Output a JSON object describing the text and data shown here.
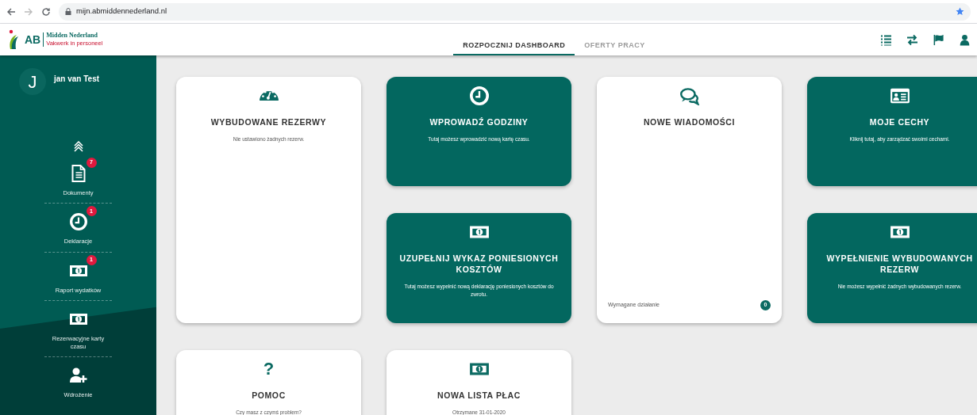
{
  "browser": {
    "url": "mijn.abmiddennederland.nl"
  },
  "logo": {
    "mark": "AB",
    "name": "Midden Nederland",
    "tagline": "Vakwerk in personeel"
  },
  "tabs": [
    {
      "label": "ROZPOCZNIJ DASHBOARD",
      "selected": true
    },
    {
      "label": "OFERTY PRACY",
      "selected": false
    }
  ],
  "user": {
    "initial": "J",
    "name": "jan van Test"
  },
  "sidebar": {
    "items": [
      {
        "label": "Dokumenty",
        "badge": "7"
      },
      {
        "label": "Deklaracje",
        "badge": "1"
      },
      {
        "label": "Raport wydatków",
        "badge": "1"
      },
      {
        "label": "Rezerwacyjne karty czasu"
      },
      {
        "label": "Wdrożenie"
      }
    ]
  },
  "cards": [
    {
      "kind": "tall",
      "highlighted": false,
      "title": "WYBUDOWANE REZERWY",
      "text": "Nie ustawiono żadnych rezerw."
    },
    {
      "kind": "short",
      "highlighted": true,
      "title": "WPROWADŹ GODZINY",
      "text": "Tutaj możesz wprowadzić nową kartę czasu."
    },
    {
      "kind": "tall",
      "highlighted": false,
      "title": "NOWE WIADOMOŚCI",
      "footer": {
        "label": "Wymagane działanie",
        "count": "0"
      }
    },
    {
      "kind": "short",
      "highlighted": true,
      "title": "MOJE CECHY",
      "text": "Kliknij tutaj, aby zarządzać swoimi cechami."
    },
    {
      "kind": "short",
      "highlighted": true,
      "title": "UZUPEŁNIJ WYKAZ PONIESIONYCH KOSZTÓW",
      "text": "Tutaj możesz wypełnić nową deklarację poniesionych kosztów do zwrotu."
    },
    {
      "kind": "short",
      "highlighted": true,
      "title": "WYPEŁNIENIE WYBUDOWANYCH REZERW",
      "text": "Nie możesz wypełnić żadnych wybudowanych rezerw."
    },
    {
      "kind": "short",
      "highlighted": false,
      "symbol": "?",
      "title": "POMOC",
      "text": "Czy masz z czymś problem?"
    },
    {
      "kind": "short",
      "highlighted": false,
      "title": "NOWA LISTA PŁAC",
      "text": "Otrzymane 31-01-2020"
    }
  ]
}
